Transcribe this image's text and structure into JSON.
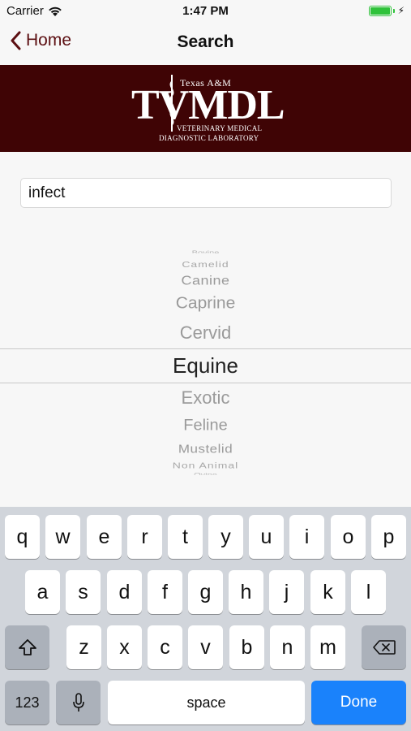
{
  "status_bar": {
    "carrier": "Carrier",
    "time": "1:47 PM"
  },
  "nav": {
    "back_label": "Home",
    "title": "Search"
  },
  "banner": {
    "logo_top": "Texas A&M",
    "logo_main": "TVMDL",
    "logo_sub1": "Veterinary Medical",
    "logo_sub2": "Diagnostic Laboratory",
    "background_color": "#3f0405"
  },
  "search": {
    "value": "infect"
  },
  "picker": {
    "items": [
      "Bovine",
      "Camelid",
      "Canine",
      "Caprine",
      "Cervid",
      "Equine",
      "Exotic",
      "Feline",
      "Mustelid",
      "Non Animal",
      "Ovine"
    ],
    "selected": "Equine"
  },
  "keyboard": {
    "row1": [
      "q",
      "w",
      "e",
      "r",
      "t",
      "y",
      "u",
      "i",
      "o",
      "p"
    ],
    "row2": [
      "a",
      "s",
      "d",
      "f",
      "g",
      "h",
      "j",
      "k",
      "l"
    ],
    "row3": [
      "z",
      "x",
      "c",
      "v",
      "b",
      "n",
      "m"
    ],
    "numbers_label": "123",
    "space_label": "space",
    "done_label": "Done",
    "done_color": "#1a82fb"
  },
  "colors": {
    "accent": "#5c0f12",
    "battery": "#2fc23a"
  }
}
